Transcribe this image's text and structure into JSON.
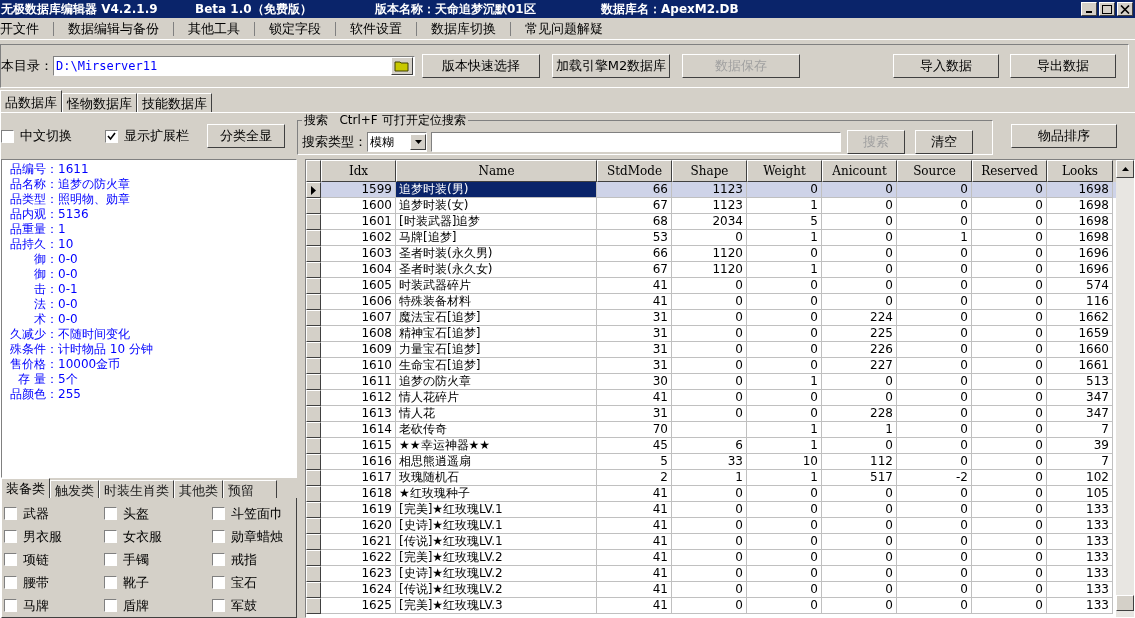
{
  "window": {
    "title_parts": [
      "无极数据库编辑器 V4.2.1.9",
      "Beta 1.0（免费版）",
      "版本名称：天命追梦沉默01区",
      "数据库名：ApexM2.DB"
    ]
  },
  "menu": [
    "开文件",
    "数据编辑与备份",
    "其他工具",
    "锁定字段",
    "软件设置",
    "数据库切换",
    "常见问题解疑"
  ],
  "toolbar": {
    "path_label": "本目录：",
    "path_value": "D:\\Mirserver11",
    "buttons": [
      {
        "label": "版本快速选择",
        "disabled": false
      },
      {
        "label": "加载引擎M2数据库",
        "disabled": false
      },
      {
        "label": "数据保存",
        "disabled": true
      }
    ],
    "right_buttons": [
      {
        "label": "导入数据",
        "disabled": false
      },
      {
        "label": "导出数据",
        "disabled": false
      }
    ]
  },
  "db_tabs": [
    {
      "label": "品数据库",
      "selected": true
    },
    {
      "label": "怪物数据库",
      "selected": false
    },
    {
      "label": "技能数据库",
      "selected": false
    }
  ],
  "options": [
    {
      "label": "中文切换",
      "checked": false
    },
    {
      "label": "显示扩展栏",
      "checked": true
    }
  ],
  "show_all_button": "分类全显",
  "search": {
    "legend": "搜索   Ctrl+F 可打开定位搜索",
    "type_label": "搜索类型：",
    "type_value": "模糊",
    "search_button": {
      "label": "搜索",
      "disabled": true
    },
    "clear_button": "清空"
  },
  "sort_button": "物品排序",
  "info": [
    {
      "label": "品编号：",
      "value": "1611"
    },
    {
      "label": "品名称：",
      "value": "追梦の防火章"
    },
    {
      "label": "品类型：",
      "value": "照明物、勋章"
    },
    {
      "label": "品内观：",
      "value": "5136"
    },
    {
      "label": "品重量：",
      "value": "1"
    },
    {
      "label": "品持久：",
      "value": "10"
    },
    {
      "label": "御：",
      "value": "0-0"
    },
    {
      "label": "御：",
      "value": "0-0"
    },
    {
      "label": "击：",
      "value": "0-1"
    },
    {
      "label": "法：",
      "value": "0-0"
    },
    {
      "label": "术：",
      "value": "0-0"
    },
    {
      "label": "久减少：",
      "value": "不随时间变化"
    },
    {
      "label": "殊条件：",
      "value": "计时物品 10 分钟"
    },
    {
      "label": "售价格：",
      "value": "10000金币"
    },
    {
      "label": "存 量：",
      "value": "5个"
    },
    {
      "label": "品颜色：",
      "value": "255"
    }
  ],
  "category_tabs": [
    {
      "label": "装备类",
      "selected": true
    },
    {
      "label": "触发类",
      "selected": false
    },
    {
      "label": "时装生肖类",
      "selected": false
    },
    {
      "label": "其他类",
      "selected": false
    },
    {
      "label": "预留",
      "selected": false
    }
  ],
  "categories": [
    {
      "label": "武器",
      "checked": false
    },
    {
      "label": "头盔",
      "checked": false
    },
    {
      "label": "斗笠面巾",
      "checked": false
    },
    {
      "label": "男衣服",
      "checked": false
    },
    {
      "label": "女衣服",
      "checked": false
    },
    {
      "label": "勋章蜡烛",
      "checked": false
    },
    {
      "label": "项链",
      "checked": false
    },
    {
      "label": "手镯",
      "checked": false
    },
    {
      "label": "戒指",
      "checked": false
    },
    {
      "label": "腰带",
      "checked": false
    },
    {
      "label": "靴子",
      "checked": false
    },
    {
      "label": "宝石",
      "checked": false
    },
    {
      "label": "马牌",
      "checked": false
    },
    {
      "label": "盾牌",
      "checked": false
    },
    {
      "label": "军鼓",
      "checked": false
    }
  ],
  "table": {
    "columns": [
      "Idx",
      "Name",
      "StdMode",
      "Shape",
      "Weight",
      "Anicount",
      "Source",
      "Reserved",
      "Looks"
    ],
    "rows": [
      {
        "cells": [
          "1599",
          "追梦时装(男)",
          "66",
          "1123",
          "0",
          "0",
          "0",
          "0",
          "1698"
        ],
        "selected": true
      },
      {
        "cells": [
          "1600",
          "追梦时装(女)",
          "67",
          "1123",
          "1",
          "0",
          "0",
          "0",
          "1698"
        ],
        "selected": false
      },
      {
        "cells": [
          "1601",
          "[时装武器]追梦",
          "68",
          "2034",
          "5",
          "0",
          "0",
          "0",
          "1698"
        ],
        "selected": false
      },
      {
        "cells": [
          "1602",
          "马牌[追梦]",
          "53",
          "0",
          "1",
          "0",
          "1",
          "0",
          "1698"
        ],
        "selected": false
      },
      {
        "cells": [
          "1603",
          "圣者时装(永久男)",
          "66",
          "1120",
          "0",
          "0",
          "0",
          "0",
          "1696"
        ],
        "selected": false
      },
      {
        "cells": [
          "1604",
          "圣者时装(永久女)",
          "67",
          "1120",
          "1",
          "0",
          "0",
          "0",
          "1696"
        ],
        "selected": false
      },
      {
        "cells": [
          "1605",
          "时装武器碎片",
          "41",
          "0",
          "0",
          "0",
          "0",
          "0",
          "574"
        ],
        "selected": false
      },
      {
        "cells": [
          "1606",
          "特殊装备材料",
          "41",
          "0",
          "0",
          "0",
          "0",
          "0",
          "116"
        ],
        "selected": false
      },
      {
        "cells": [
          "1607",
          "魔法宝石[追梦]",
          "31",
          "0",
          "0",
          "224",
          "0",
          "0",
          "1662"
        ],
        "selected": false
      },
      {
        "cells": [
          "1608",
          "精神宝石[追梦]",
          "31",
          "0",
          "0",
          "225",
          "0",
          "0",
          "1659"
        ],
        "selected": false
      },
      {
        "cells": [
          "1609",
          "力量宝石[追梦]",
          "31",
          "0",
          "0",
          "226",
          "0",
          "0",
          "1660"
        ],
        "selected": false
      },
      {
        "cells": [
          "1610",
          "生命宝石[追梦]",
          "31",
          "0",
          "0",
          "227",
          "0",
          "0",
          "1661"
        ],
        "selected": false
      },
      {
        "cells": [
          "1611",
          "追梦の防火章",
          "30",
          "0",
          "1",
          "0",
          "0",
          "0",
          "513"
        ],
        "selected": false
      },
      {
        "cells": [
          "1612",
          "情人花碎片",
          "41",
          "0",
          "0",
          "0",
          "0",
          "0",
          "347"
        ],
        "selected": false
      },
      {
        "cells": [
          "1613",
          "情人花",
          "31",
          "0",
          "0",
          "228",
          "0",
          "0",
          "347"
        ],
        "selected": false
      },
      {
        "cells": [
          "1614",
          "老砍传奇",
          "70",
          "",
          "1",
          "1",
          "0",
          "0",
          "7"
        ],
        "selected": false
      },
      {
        "cells": [
          "1615",
          "★★幸运神器★★",
          "45",
          "6",
          "1",
          "0",
          "0",
          "0",
          "39"
        ],
        "selected": false
      },
      {
        "cells": [
          "1616",
          "相思熊逍遥扇",
          "5",
          "33",
          "10",
          "112",
          "0",
          "0",
          "7"
        ],
        "selected": false
      },
      {
        "cells": [
          "1617",
          "玫瑰随机石",
          "2",
          "1",
          "1",
          "517",
          "-2",
          "0",
          "102"
        ],
        "selected": false
      },
      {
        "cells": [
          "1618",
          "★红玫瑰种子",
          "41",
          "0",
          "0",
          "0",
          "0",
          "0",
          "105"
        ],
        "selected": false
      },
      {
        "cells": [
          "1619",
          "[完美]★红玫瑰LV.1",
          "41",
          "0",
          "0",
          "0",
          "0",
          "0",
          "133"
        ],
        "selected": false
      },
      {
        "cells": [
          "1620",
          "[史诗]★红玫瑰LV.1",
          "41",
          "0",
          "0",
          "0",
          "0",
          "0",
          "133"
        ],
        "selected": false
      },
      {
        "cells": [
          "1621",
          "[传说]★红玫瑰LV.1",
          "41",
          "0",
          "0",
          "0",
          "0",
          "0",
          "133"
        ],
        "selected": false
      },
      {
        "cells": [
          "1622",
          "[完美]★红玫瑰LV.2",
          "41",
          "0",
          "0",
          "0",
          "0",
          "0",
          "133"
        ],
        "selected": false
      },
      {
        "cells": [
          "1623",
          "[史诗]★红玫瑰LV.2",
          "41",
          "0",
          "0",
          "0",
          "0",
          "0",
          "133"
        ],
        "selected": false
      },
      {
        "cells": [
          "1624",
          "[传说]★红玫瑰LV.2",
          "41",
          "0",
          "0",
          "0",
          "0",
          "0",
          "133"
        ],
        "selected": false
      },
      {
        "cells": [
          "1625",
          "[完美]★红玫瑰LV.3",
          "41",
          "0",
          "0",
          "0",
          "0",
          "0",
          "133"
        ],
        "selected": false
      }
    ]
  }
}
